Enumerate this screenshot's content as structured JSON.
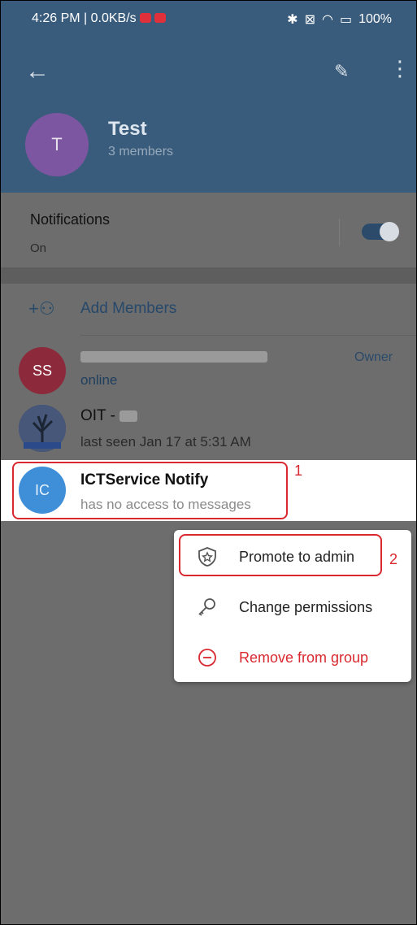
{
  "status_bar": {
    "time": "4:26 PM | 0.0KB/s",
    "battery": "100%",
    "icons": [
      "bluetooth-icon",
      "sim-icon",
      "wifi-icon",
      "battery-icon"
    ]
  },
  "header": {
    "title": "Test",
    "subtitle": "3 members",
    "avatar_letter": "T"
  },
  "notifications": {
    "label": "Notifications",
    "value": "On",
    "toggle_on": true
  },
  "add_members": {
    "label": "Add Members"
  },
  "members": [
    {
      "avatar": "SS",
      "avatar_color": "#c0304a",
      "name": "",
      "status": "online",
      "role": "Owner"
    },
    {
      "avatar": "",
      "avatar_color": "#4a5f82",
      "name": "OIT -",
      "status": "last seen Jan 17 at 5:31 AM",
      "role": ""
    },
    {
      "avatar": "IC",
      "avatar_color": "#3f8fd8",
      "name": "ICTService Notify",
      "status": "has no access to messages",
      "role": ""
    }
  ],
  "context_menu": {
    "items": [
      {
        "label": "Promote to admin",
        "icon": "shield-star-icon",
        "color": "#222222"
      },
      {
        "label": "Change permissions",
        "icon": "key-icon",
        "color": "#222222"
      },
      {
        "label": "Remove from group",
        "icon": "minus-circle-icon",
        "color": "#d9282f"
      }
    ]
  },
  "annotations": {
    "step1": "1",
    "step2": "2"
  },
  "colors": {
    "header": "#3a5c7c",
    "accent": "#3f8fd8",
    "annotation": "#d9282f"
  }
}
